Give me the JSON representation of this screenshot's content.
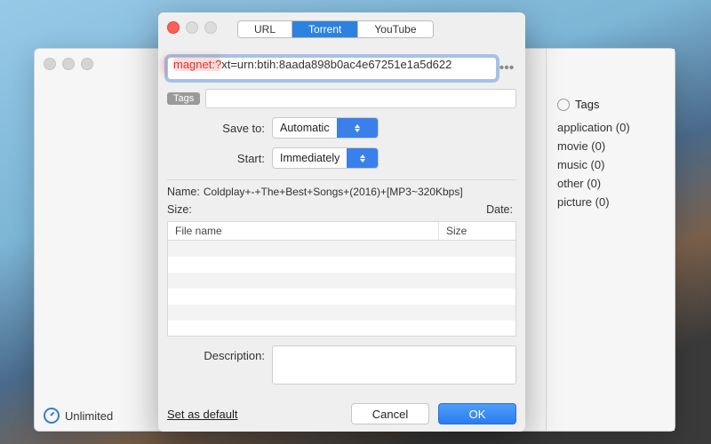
{
  "tabs": {
    "url": "URL",
    "torrent": "Torrent",
    "youtube": "YouTube"
  },
  "url_field": {
    "highlight": "magnet:?",
    "rest": "xt=urn:btih:8aada898b0ac4e67251e1a5d622"
  },
  "tags_chip": "Tags",
  "form": {
    "save_to_label": "Save to:",
    "save_to_value": "Automatic",
    "start_label": "Start:",
    "start_value": "Immediately"
  },
  "meta": {
    "name_label": "Name:",
    "name_value": "Coldplay+-+The+Best+Songs+(2016)+[MP3~320Kbps]",
    "size_label": "Size:",
    "size_value": "",
    "date_label": "Date:",
    "date_value": ""
  },
  "table": {
    "col_file": "File name",
    "col_size": "Size"
  },
  "description_label": "Description:",
  "footer": {
    "set_default": "Set as default",
    "cancel": "Cancel",
    "ok": "OK"
  },
  "backwin": {
    "status": "Unlimited",
    "tags_header": "Tags",
    "tags": [
      "application (0)",
      "movie (0)",
      "music (0)",
      "other (0)",
      "picture (0)"
    ]
  }
}
